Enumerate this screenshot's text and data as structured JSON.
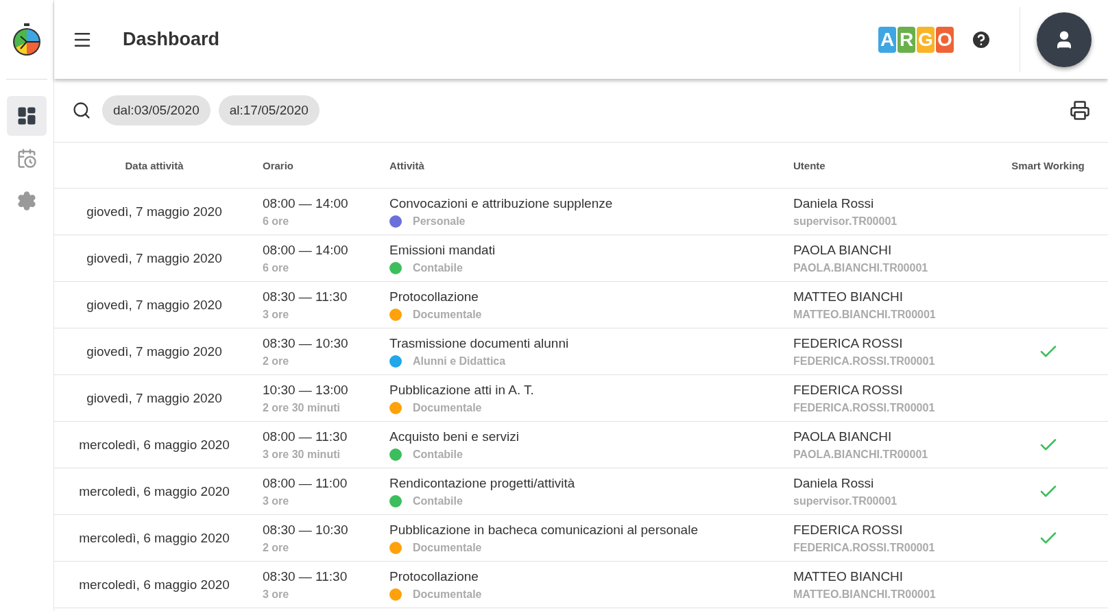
{
  "header": {
    "title": "Dashboard",
    "logo_letters": [
      {
        "letter": "A",
        "color": "#3ea6e3"
      },
      {
        "letter": "R",
        "color": "#6ab04c"
      },
      {
        "letter": "G",
        "color": "#f9b428"
      },
      {
        "letter": "O",
        "color": "#ee6436"
      }
    ]
  },
  "sidebar": {
    "items": [
      {
        "kind": "dashboard",
        "selected": true
      },
      {
        "kind": "calendar",
        "selected": false
      },
      {
        "kind": "settings",
        "selected": false
      }
    ]
  },
  "filters": {
    "chips": [
      "dal:03/05/2020",
      "al:17/05/2020"
    ]
  },
  "table": {
    "columns": [
      "Data attività",
      "Orario",
      "Attività",
      "Utente",
      "Smart Working"
    ],
    "rows": [
      {
        "date": "giovedì, 7 maggio 2020",
        "time": "08:00 — 14:00",
        "duration": "6 ore",
        "activity": "Convocazioni e attribuzione supplenze",
        "category": "Personale",
        "color": "#6b6fdc",
        "user": "Daniela Rossi",
        "login": "supervisor.TR00001",
        "smart_working": false
      },
      {
        "date": "giovedì, 7 maggio 2020",
        "time": "08:00 — 14:00",
        "duration": "6 ore",
        "activity": "Emissioni mandati",
        "category": "Contabile",
        "color": "#3dbe5c",
        "user": "PAOLA BIANCHI",
        "login": "PAOLA.BIANCHI.TR00001",
        "smart_working": false
      },
      {
        "date": "giovedì, 7 maggio 2020",
        "time": "08:30 — 11:30",
        "duration": "3 ore",
        "activity": "Protocollazione",
        "category": "Documentale",
        "color": "#ffa10a",
        "user": "MATTEO BIANCHI",
        "login": "MATTEO.BIANCHI.TR00001",
        "smart_working": false
      },
      {
        "date": "giovedì, 7 maggio 2020",
        "time": "08:30 — 10:30",
        "duration": "2 ore",
        "activity": "Trasmissione documenti alunni",
        "category": "Alunni e Didattica",
        "color": "#22a7e8",
        "user": "FEDERICA ROSSI",
        "login": "FEDERICA.ROSSI.TR00001",
        "smart_working": true
      },
      {
        "date": "giovedì, 7 maggio 2020",
        "time": "10:30 — 13:00",
        "duration": "2 ore 30 minuti",
        "activity": "Pubblicazione atti in A. T.",
        "category": "Documentale",
        "color": "#ffa10a",
        "user": "FEDERICA ROSSI",
        "login": "FEDERICA.ROSSI.TR00001",
        "smart_working": false
      },
      {
        "date": "mercoledì, 6 maggio 2020",
        "time": "08:00 — 11:30",
        "duration": "3 ore 30 minuti",
        "activity": "Acquisto beni e servizi",
        "category": "Contabile",
        "color": "#3dbe5c",
        "user": "PAOLA BIANCHI",
        "login": "PAOLA.BIANCHI.TR00001",
        "smart_working": true
      },
      {
        "date": "mercoledì, 6 maggio 2020",
        "time": "08:00 — 11:00",
        "duration": "3 ore",
        "activity": "Rendicontazione progetti/attività",
        "category": "Contabile",
        "color": "#3dbe5c",
        "user": "Daniela Rossi",
        "login": "supervisor.TR00001",
        "smart_working": true
      },
      {
        "date": "mercoledì, 6 maggio 2020",
        "time": "08:30 — 10:30",
        "duration": "2 ore",
        "activity": "Pubblicazione in bacheca comunicazioni al personale",
        "category": "Documentale",
        "color": "#ffa10a",
        "user": "FEDERICA ROSSI",
        "login": "FEDERICA.ROSSI.TR00001",
        "smart_working": true
      },
      {
        "date": "mercoledì, 6 maggio 2020",
        "time": "08:30 — 11:30",
        "duration": "3 ore",
        "activity": "Protocollazione",
        "category": "Documentale",
        "color": "#ffa10a",
        "user": "MATTEO BIANCHI",
        "login": "MATTEO.BIANCHI.TR00001",
        "smart_working": false
      }
    ]
  }
}
